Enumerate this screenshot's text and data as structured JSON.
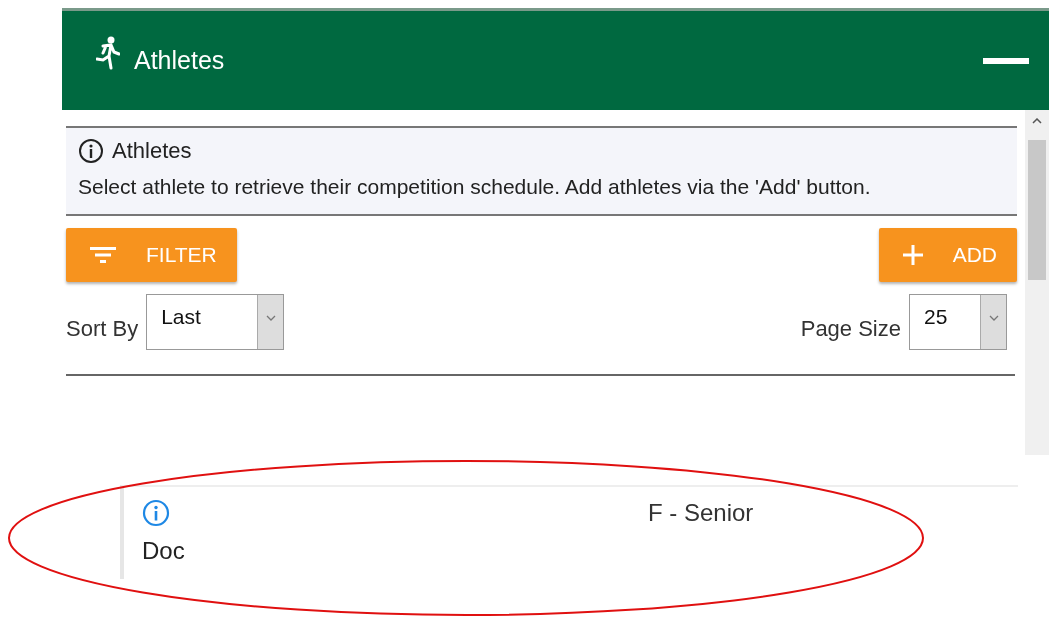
{
  "header": {
    "title": "Athletes"
  },
  "info": {
    "title": "Athletes",
    "text": "Select athlete to retrieve their competition schedule. Add athletes via the 'Add' button."
  },
  "buttons": {
    "filter": "FILTER",
    "add": "ADD"
  },
  "sort": {
    "label": "Sort By",
    "value": "Last"
  },
  "page_size": {
    "label": "Page Size",
    "value": "25"
  },
  "athlete_card": {
    "category": "F - Senior",
    "name": "Doc"
  }
}
